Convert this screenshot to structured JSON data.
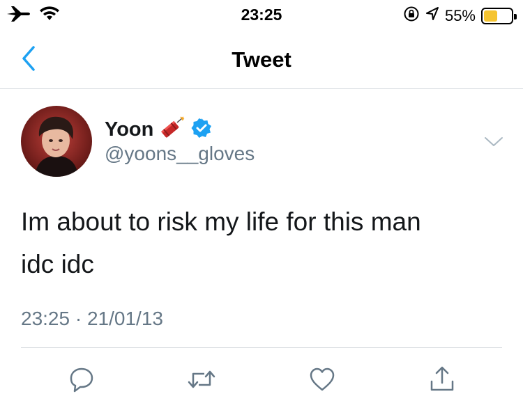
{
  "status_bar": {
    "time": "23:25",
    "battery_percent_text": "55%",
    "battery_level": 0.55,
    "icons": [
      "airplane-icon",
      "wifi-icon",
      "orientation-lock-icon",
      "location-icon",
      "battery-icon"
    ]
  },
  "nav": {
    "title": "Tweet",
    "back_icon": "chevron-left-icon"
  },
  "tweet": {
    "author": {
      "display_name": "Yoon",
      "emoji": "🧨",
      "verified": true,
      "handle": "@yoons__gloves"
    },
    "text_line1": "Im about to risk my life for this man",
    "text_line2": "idc idc",
    "time": "23:25",
    "separator": "·",
    "date": "21/01/13",
    "actions": [
      "reply-icon",
      "retweet-icon",
      "like-icon",
      "share-icon"
    ]
  },
  "colors": {
    "accent": "#1da1f2",
    "text_primary": "#14171a",
    "text_secondary": "#657786",
    "divider": "#d7dce0",
    "battery_fill": "#f5c431"
  }
}
